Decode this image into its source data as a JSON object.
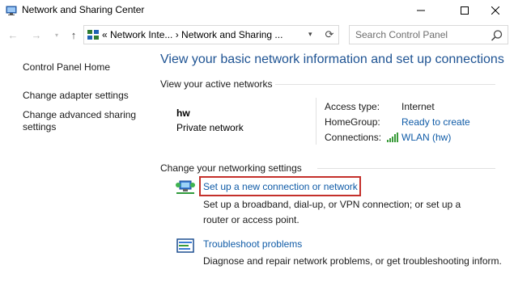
{
  "window": {
    "title": "Network and Sharing Center"
  },
  "address": {
    "path": "« Network Inte... › Network and Sharing ...",
    "search_placeholder": "Search Control Panel"
  },
  "sidebar": {
    "items": [
      {
        "label": "Control Panel Home"
      },
      {
        "label": "Change adapter settings"
      },
      {
        "label": "Change advanced sharing"
      },
      {
        "label": "settings"
      }
    ]
  },
  "main": {
    "title": "View your basic network information and set up connections",
    "active_header": "View your active networks",
    "network": {
      "name": "hw",
      "type": "Private network",
      "access_type_label": "Access type:",
      "access_type_value": "Internet",
      "homegroup_label": "HomeGroup:",
      "homegroup_value": "Ready to create",
      "connections_label": "Connections:",
      "connections_value": "WLAN (hw)"
    },
    "settings_header": "Change your networking settings",
    "tasks": [
      {
        "label": "Set up a new connection or network",
        "desc_line1": "Set up a broadband, dial-up, or VPN connection; or set up a",
        "desc_line2": "router or access point."
      },
      {
        "label": "Troubleshoot problems",
        "desc_line1": "Diagnose and repair network problems, or get troubleshooting inform."
      }
    ]
  },
  "colors": {
    "link": "#0f5ba7",
    "title_blue": "#1e5393",
    "highlight_red": "#c4302b"
  }
}
